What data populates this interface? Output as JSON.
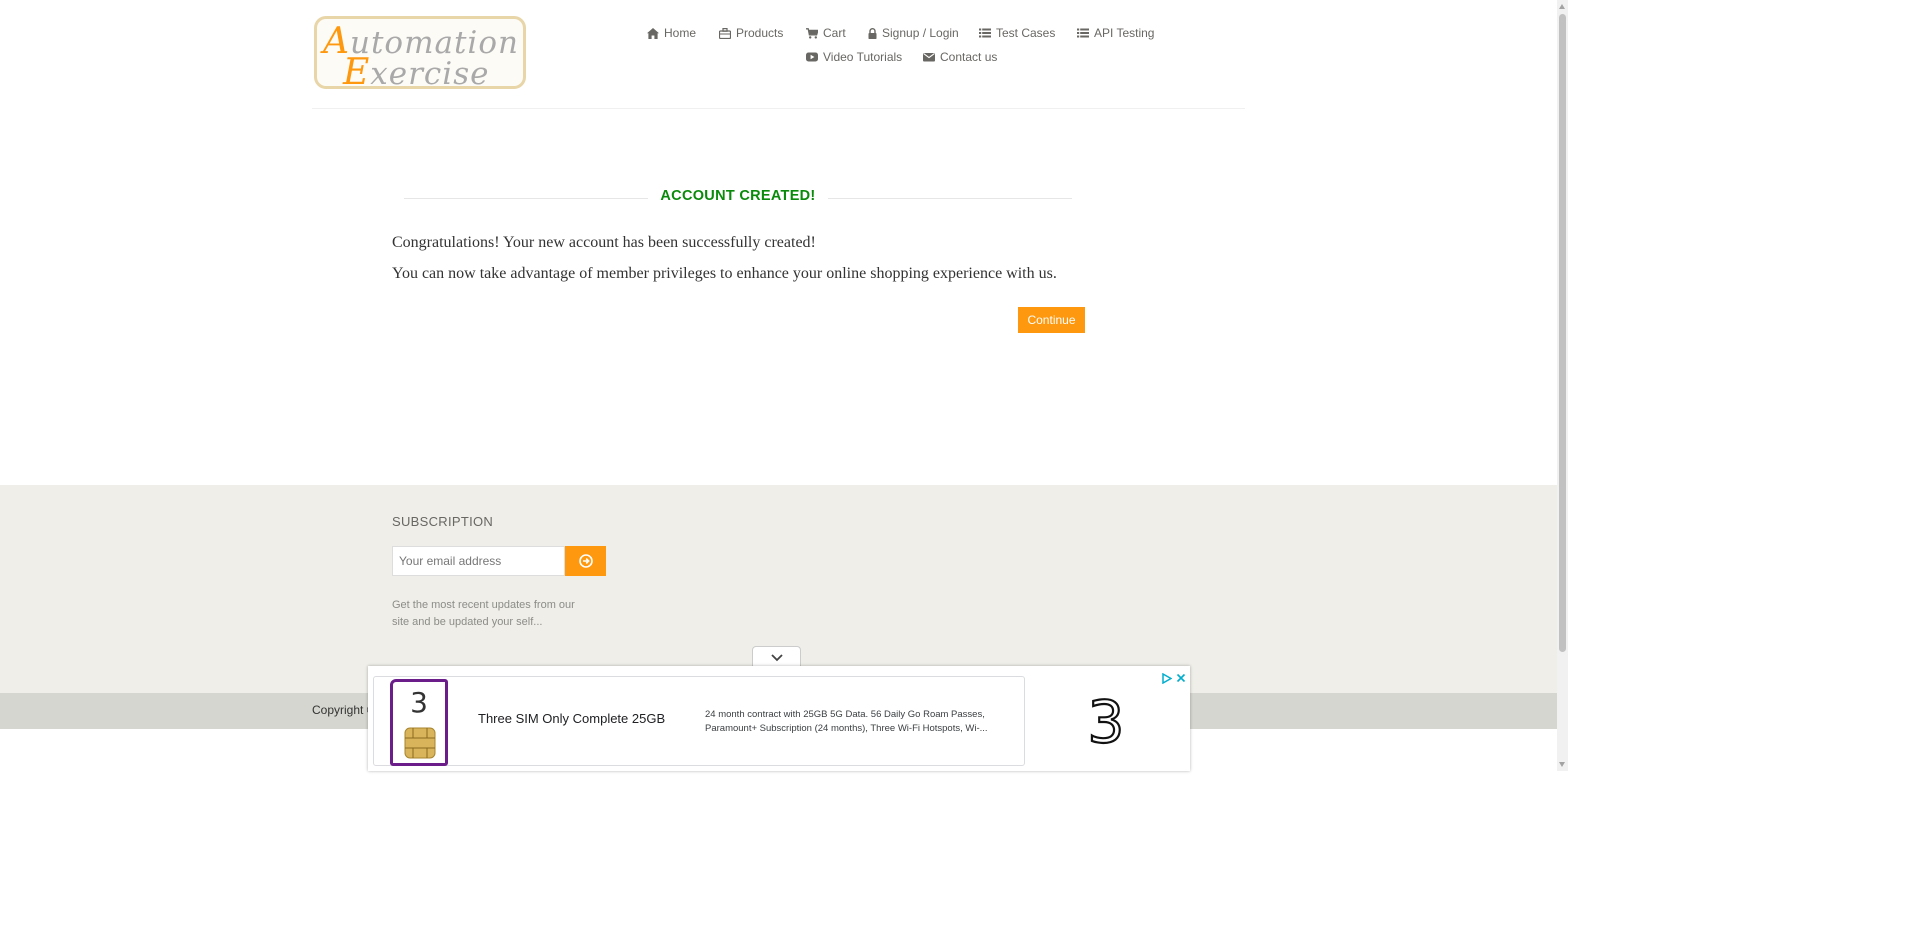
{
  "header": {
    "logo": {
      "line1": "Automation",
      "line2": "Exercise"
    },
    "nav": [
      {
        "label": "Home",
        "icon": "home-icon"
      },
      {
        "label": "Products",
        "icon": "briefcase-icon"
      },
      {
        "label": "Cart",
        "icon": "cart-icon"
      },
      {
        "label": "Signup / Login",
        "icon": "lock-icon"
      },
      {
        "label": "Test Cases",
        "icon": "list-icon"
      },
      {
        "label": "API Testing",
        "icon": "list-icon"
      },
      {
        "label": "Video Tutorials",
        "icon": "youtube-play-icon"
      },
      {
        "label": "Contact us",
        "icon": "envelope-icon"
      }
    ]
  },
  "main": {
    "title": "ACCOUNT CREATED!",
    "message1": "Congratulations! Your new account has been successfully created!",
    "message2": "You can now take advantage of member privileges to enhance your online shopping experience with us.",
    "continue_label": "Continue"
  },
  "footer": {
    "subscription_title": "SUBSCRIPTION",
    "email_placeholder": "Your email address",
    "subscription_text": "Get the most recent updates from our site and be updated your self...",
    "copyright": "Copyright ©"
  },
  "ad": {
    "headline": "Three SIM Only Complete 25GB",
    "description": "24 month contract with 25GB 5G Data. 56 Daily Go Roam Passes, Paramount+ Subscription (24 months), Three Wi-Fi Hotspots, Wi-...",
    "logo_text": "3"
  },
  "colors": {
    "accent": "#fe980f",
    "success": "#0a8a0a",
    "footer_bg": "#efeee9",
    "ad_brand": "#6b1e8a"
  }
}
